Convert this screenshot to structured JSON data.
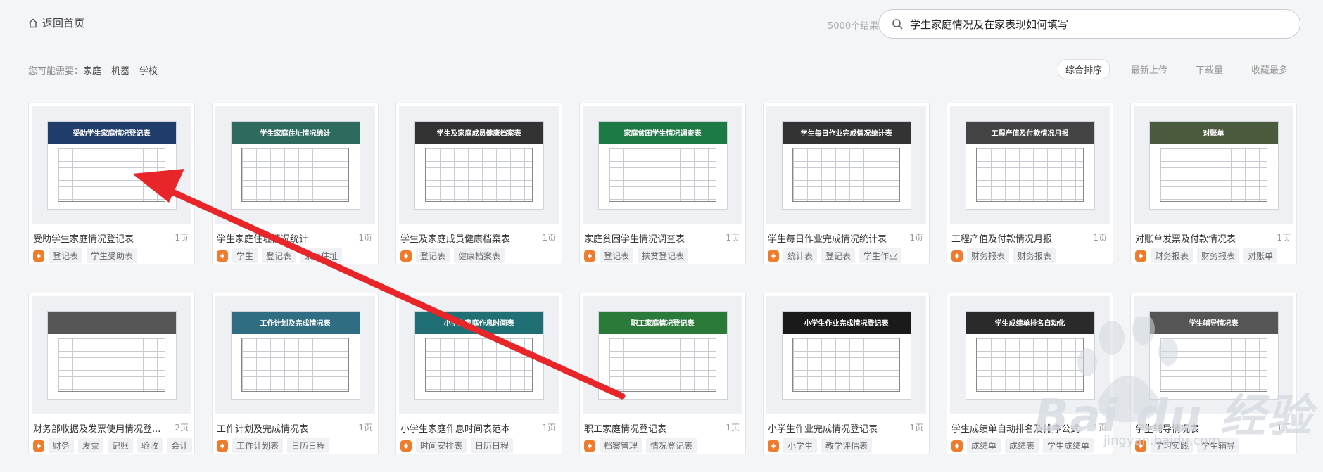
{
  "header": {
    "home_label": "返回首页",
    "result_count": "5000个结果",
    "search_value": "学生家庭情况及在家表现如何填写"
  },
  "suggest": {
    "label": "您可能需要：",
    "keywords": [
      "家庭",
      "机器",
      "学校"
    ]
  },
  "sort_tabs": [
    "综合排序",
    "最新上传",
    "下载量",
    "收藏最多"
  ],
  "active_sort": "综合排序",
  "cards": [
    {
      "title": "受助学生家庭情况登记表",
      "pages": "1页",
      "tags": [
        "登记表",
        "学生受助表"
      ],
      "thumb_title": "受助学生家庭情况登记表",
      "thumb_color": "#1f3c6a"
    },
    {
      "title": "学生家庭住址情况统计",
      "pages": "1页",
      "tags": [
        "学生",
        "登记表",
        "家庭住址"
      ],
      "thumb_title": "学生家庭住址情况统计",
      "thumb_color": "#2e6b5e"
    },
    {
      "title": "学生及家庭成员健康档案表",
      "pages": "1页",
      "tags": [
        "登记表",
        "健康档案表"
      ],
      "thumb_title": "学生及家庭成员健康档案表",
      "thumb_color": "#333333"
    },
    {
      "title": "家庭贫困学生情况调查表",
      "pages": "1页",
      "tags": [
        "登记表",
        "扶贫登记表"
      ],
      "thumb_title": "家庭贫困学生情况调查表",
      "thumb_color": "#1e7a45"
    },
    {
      "title": "学生每日作业完成情况统计表",
      "pages": "1页",
      "tags": [
        "统计表",
        "登记表",
        "学生作业"
      ],
      "thumb_title": "学生每日作业完成情况统计表",
      "thumb_color": "#333333"
    },
    {
      "title": "工程产值及付款情况月报",
      "pages": "1页",
      "tags": [
        "财务报表",
        "财务报表"
      ],
      "thumb_title": "工程产值及付款情况月报",
      "thumb_color": "#444444"
    },
    {
      "title": "对账单发票及付款情况表",
      "pages": "1页",
      "tags": [
        "财务报表",
        "财务报表",
        "对账单"
      ],
      "thumb_title": "对账单",
      "thumb_color": "#4a5a3c"
    },
    {
      "title": "财务部收据及发票使用情况登...",
      "pages": "2页",
      "tags": [
        "财务",
        "发票",
        "记账",
        "验收",
        "会计"
      ],
      "thumb_title": "",
      "thumb_color": "#555555"
    },
    {
      "title": "工作计划及完成情况表",
      "pages": "1页",
      "tags": [
        "工作计划表",
        "日历日程"
      ],
      "thumb_title": "工作计划及完成情况表",
      "thumb_color": "#2f6d82"
    },
    {
      "title": "小学生家庭作息时间表范本",
      "pages": "1页",
      "tags": [
        "时间安排表",
        "日历日程"
      ],
      "thumb_title": "小学生家庭作息时间表",
      "thumb_color": "#1f6f75"
    },
    {
      "title": "职工家庭情况登记表",
      "pages": "1页",
      "tags": [
        "档案管理",
        "情况登记表"
      ],
      "thumb_title": "职工家庭情况登记表",
      "thumb_color": "#2b7a3a"
    },
    {
      "title": "小学生作业完成情况登记表",
      "pages": "1页",
      "tags": [
        "小学生",
        "教学评估表"
      ],
      "thumb_title": "小学生作业完成情况登记表",
      "thumb_color": "#1a1a1a"
    },
    {
      "title": "学生成绩单自动排名及排序公式",
      "pages": "1页",
      "tags": [
        "成绩单",
        "成绩表",
        "学生成绩单"
      ],
      "thumb_title": "学生成绩单排名自动化",
      "thumb_color": "#2a2a2a"
    },
    {
      "title": "学生辅导情况表",
      "pages": "1页",
      "tags": [
        "学习实践",
        "学生辅导"
      ],
      "thumb_title": "学生辅导情况表",
      "thumb_color": "#555555"
    }
  ],
  "watermark": {
    "text": "Bai du 经验",
    "url": "jingyan.baidu.com"
  },
  "colors": {
    "accent": "#ef7b2c",
    "arrow": "#e8262a"
  }
}
